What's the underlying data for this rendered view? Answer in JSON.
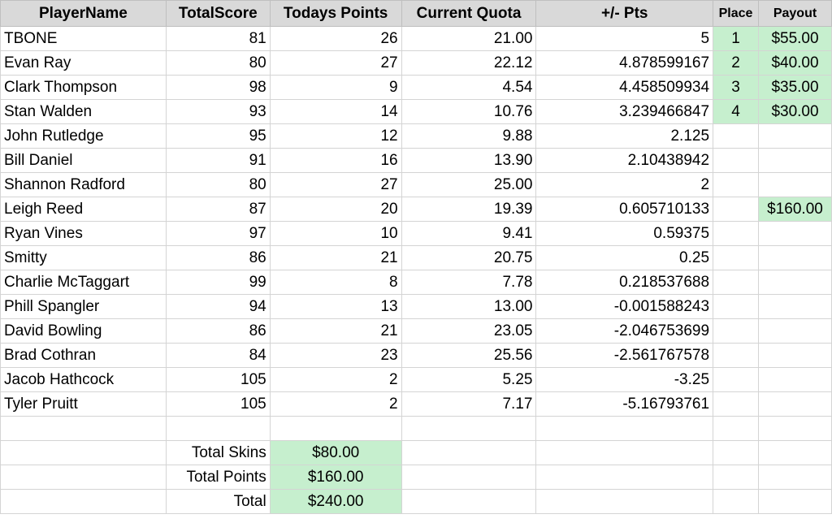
{
  "headers": {
    "player_name": "PlayerName",
    "total_score": "TotalScore",
    "todays_points": "Todays Points",
    "current_quota": "Current Quota",
    "plus_minus": "+/- Pts",
    "place": "Place",
    "payout": "Payout"
  },
  "rows": [
    {
      "name": "TBONE",
      "score": "81",
      "points": "26",
      "quota": "21.00",
      "pm": "5",
      "place": "1",
      "payout": "$55.00"
    },
    {
      "name": "Evan Ray",
      "score": "80",
      "points": "27",
      "quota": "22.12",
      "pm": "4.878599167",
      "place": "2",
      "payout": "$40.00"
    },
    {
      "name": "Clark Thompson",
      "score": "98",
      "points": "9",
      "quota": "4.54",
      "pm": "4.458509934",
      "place": "3",
      "payout": "$35.00"
    },
    {
      "name": "Stan Walden",
      "score": "93",
      "points": "14",
      "quota": "10.76",
      "pm": "3.239466847",
      "place": "4",
      "payout": "$30.00"
    },
    {
      "name": "John Rutledge",
      "score": "95",
      "points": "12",
      "quota": "9.88",
      "pm": "2.125",
      "place": "",
      "payout": ""
    },
    {
      "name": "Bill Daniel",
      "score": "91",
      "points": "16",
      "quota": "13.90",
      "pm": "2.10438942",
      "place": "",
      "payout": ""
    },
    {
      "name": "Shannon Radford",
      "score": "80",
      "points": "27",
      "quota": "25.00",
      "pm": "2",
      "place": "",
      "payout": ""
    },
    {
      "name": "Leigh Reed",
      "score": "87",
      "points": "20",
      "quota": "19.39",
      "pm": "0.605710133",
      "place": "",
      "payout": "$160.00"
    },
    {
      "name": "Ryan Vines",
      "score": "97",
      "points": "10",
      "quota": "9.41",
      "pm": "0.59375",
      "place": "",
      "payout": ""
    },
    {
      "name": "Smitty",
      "score": "86",
      "points": "21",
      "quota": "20.75",
      "pm": "0.25",
      "place": "",
      "payout": ""
    },
    {
      "name": "Charlie McTaggart",
      "score": "99",
      "points": "8",
      "quota": "7.78",
      "pm": "0.218537688",
      "place": "",
      "payout": ""
    },
    {
      "name": "Phill Spangler",
      "score": "94",
      "points": "13",
      "quota": "13.00",
      "pm": "-0.001588243",
      "place": "",
      "payout": ""
    },
    {
      "name": "David Bowling",
      "score": "86",
      "points": "21",
      "quota": "23.05",
      "pm": "-2.046753699",
      "place": "",
      "payout": ""
    },
    {
      "name": "Brad Cothran",
      "score": "84",
      "points": "23",
      "quota": "25.56",
      "pm": "-2.561767578",
      "place": "",
      "payout": ""
    },
    {
      "name": "Jacob Hathcock",
      "score": "105",
      "points": "2",
      "quota": "5.25",
      "pm": "-3.25",
      "place": "",
      "payout": ""
    },
    {
      "name": "Tyler Pruitt",
      "score": "105",
      "points": "2",
      "quota": "7.17",
      "pm": "-5.16793761",
      "place": "",
      "payout": ""
    }
  ],
  "totals": [
    {
      "label": "Total Skins",
      "value": "$80.00"
    },
    {
      "label": "Total Points",
      "value": "$160.00"
    },
    {
      "label": "Total",
      "value": "$240.00"
    }
  ],
  "colors": {
    "highlight_fill": "#c6efce",
    "highlight_text": "#006100",
    "header_fill": "#d9d9d9"
  }
}
